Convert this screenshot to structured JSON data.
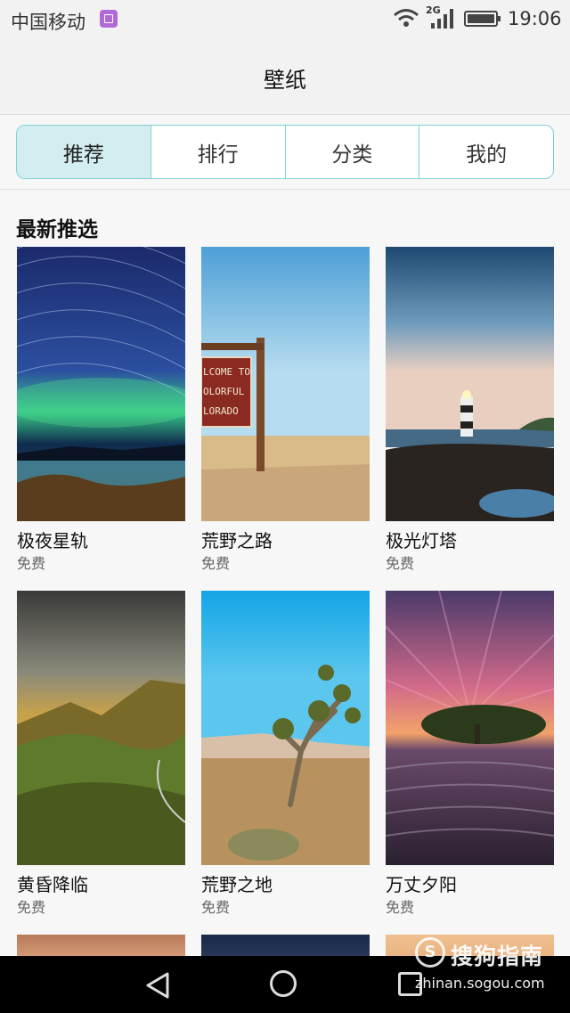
{
  "status_bar": {
    "carrier": "中国移动",
    "network": "2G",
    "time": "19:06"
  },
  "header": {
    "title": "壁纸"
  },
  "tabs": [
    {
      "label": "推荐",
      "active": true
    },
    {
      "label": "排行",
      "active": false
    },
    {
      "label": "分类",
      "active": false
    },
    {
      "label": "我的",
      "active": false
    }
  ],
  "section": {
    "title": "最新推选"
  },
  "wallpapers": [
    {
      "name": "极夜星轨",
      "price": "免费"
    },
    {
      "name": "荒野之路",
      "price": "免费"
    },
    {
      "name": "极光灯塔",
      "price": "免费"
    },
    {
      "name": "黄昏降临",
      "price": "免费"
    },
    {
      "name": "荒野之地",
      "price": "免费"
    },
    {
      "name": "万丈夕阳",
      "price": "免费"
    }
  ],
  "sign_text": [
    "LCOME TO",
    "OLORFUL",
    "LORADO"
  ],
  "watermark": {
    "logo": "S",
    "text": "搜狗指南",
    "url": "zhinan.sogou.com"
  },
  "colors": {
    "accent": "#7fd0d3",
    "active_tab_bg": "#d3eef0"
  }
}
